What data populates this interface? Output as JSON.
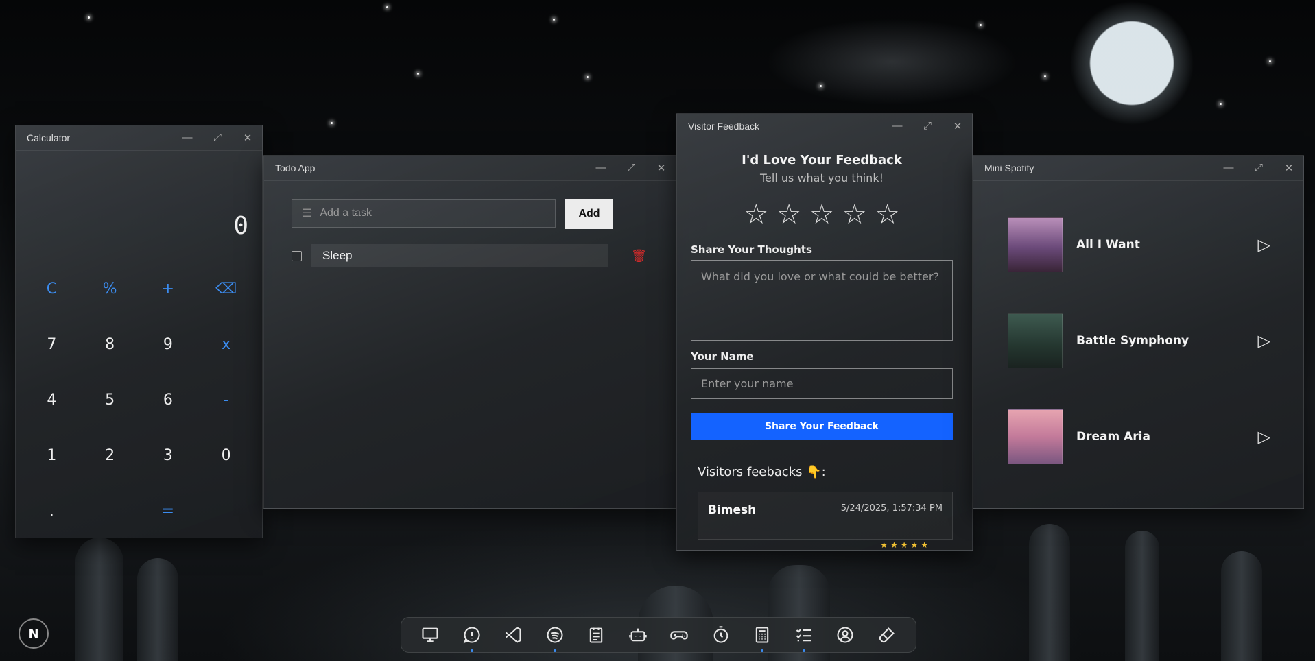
{
  "calculator": {
    "title": "Calculator",
    "display": "0",
    "keys": [
      "C",
      "%",
      "+",
      "⌫",
      "7",
      "8",
      "9",
      "x",
      "4",
      "5",
      "6",
      "-",
      "1",
      "2",
      "3",
      "0",
      ".",
      "",
      "=",
      ""
    ]
  },
  "todo": {
    "title": "Todo App",
    "input_placeholder": "Add a task",
    "add_label": "Add",
    "tasks": [
      {
        "text": "Sleep",
        "done": false
      }
    ]
  },
  "feedback": {
    "title": "Visitor Feedback",
    "heading": "I'd Love Your Feedback",
    "subheading": "Tell us what you think!",
    "rating_max": 5,
    "thoughts_label": "Share Your Thoughts",
    "thoughts_placeholder": "What did you love or what could be better?",
    "name_label": "Your Name",
    "name_placeholder": "Enter your name",
    "submit_label": "Share Your Feedback",
    "list_title": "Visitors feebacks 👇:",
    "entries": [
      {
        "name": "Bimesh",
        "date": "5/24/2025, 1:57:34 PM"
      }
    ]
  },
  "spotify": {
    "title": "Mini Spotify",
    "songs": [
      {
        "title": "All I Want"
      },
      {
        "title": "Battle Symphony"
      },
      {
        "title": "Dream Aria"
      }
    ]
  },
  "start_label": "N",
  "dock": [
    "monitor-icon",
    "feedback-icon",
    "vscode-icon",
    "spotify-icon",
    "notepad-icon",
    "robot-icon",
    "gamepad-icon",
    "timer-icon",
    "calculator-icon",
    "checklist-icon",
    "user-icon",
    "brush-icon"
  ],
  "colors": {
    "accent": "#1463ff",
    "calc_operator": "#3b8cf0",
    "delete": "#d02a2a"
  }
}
